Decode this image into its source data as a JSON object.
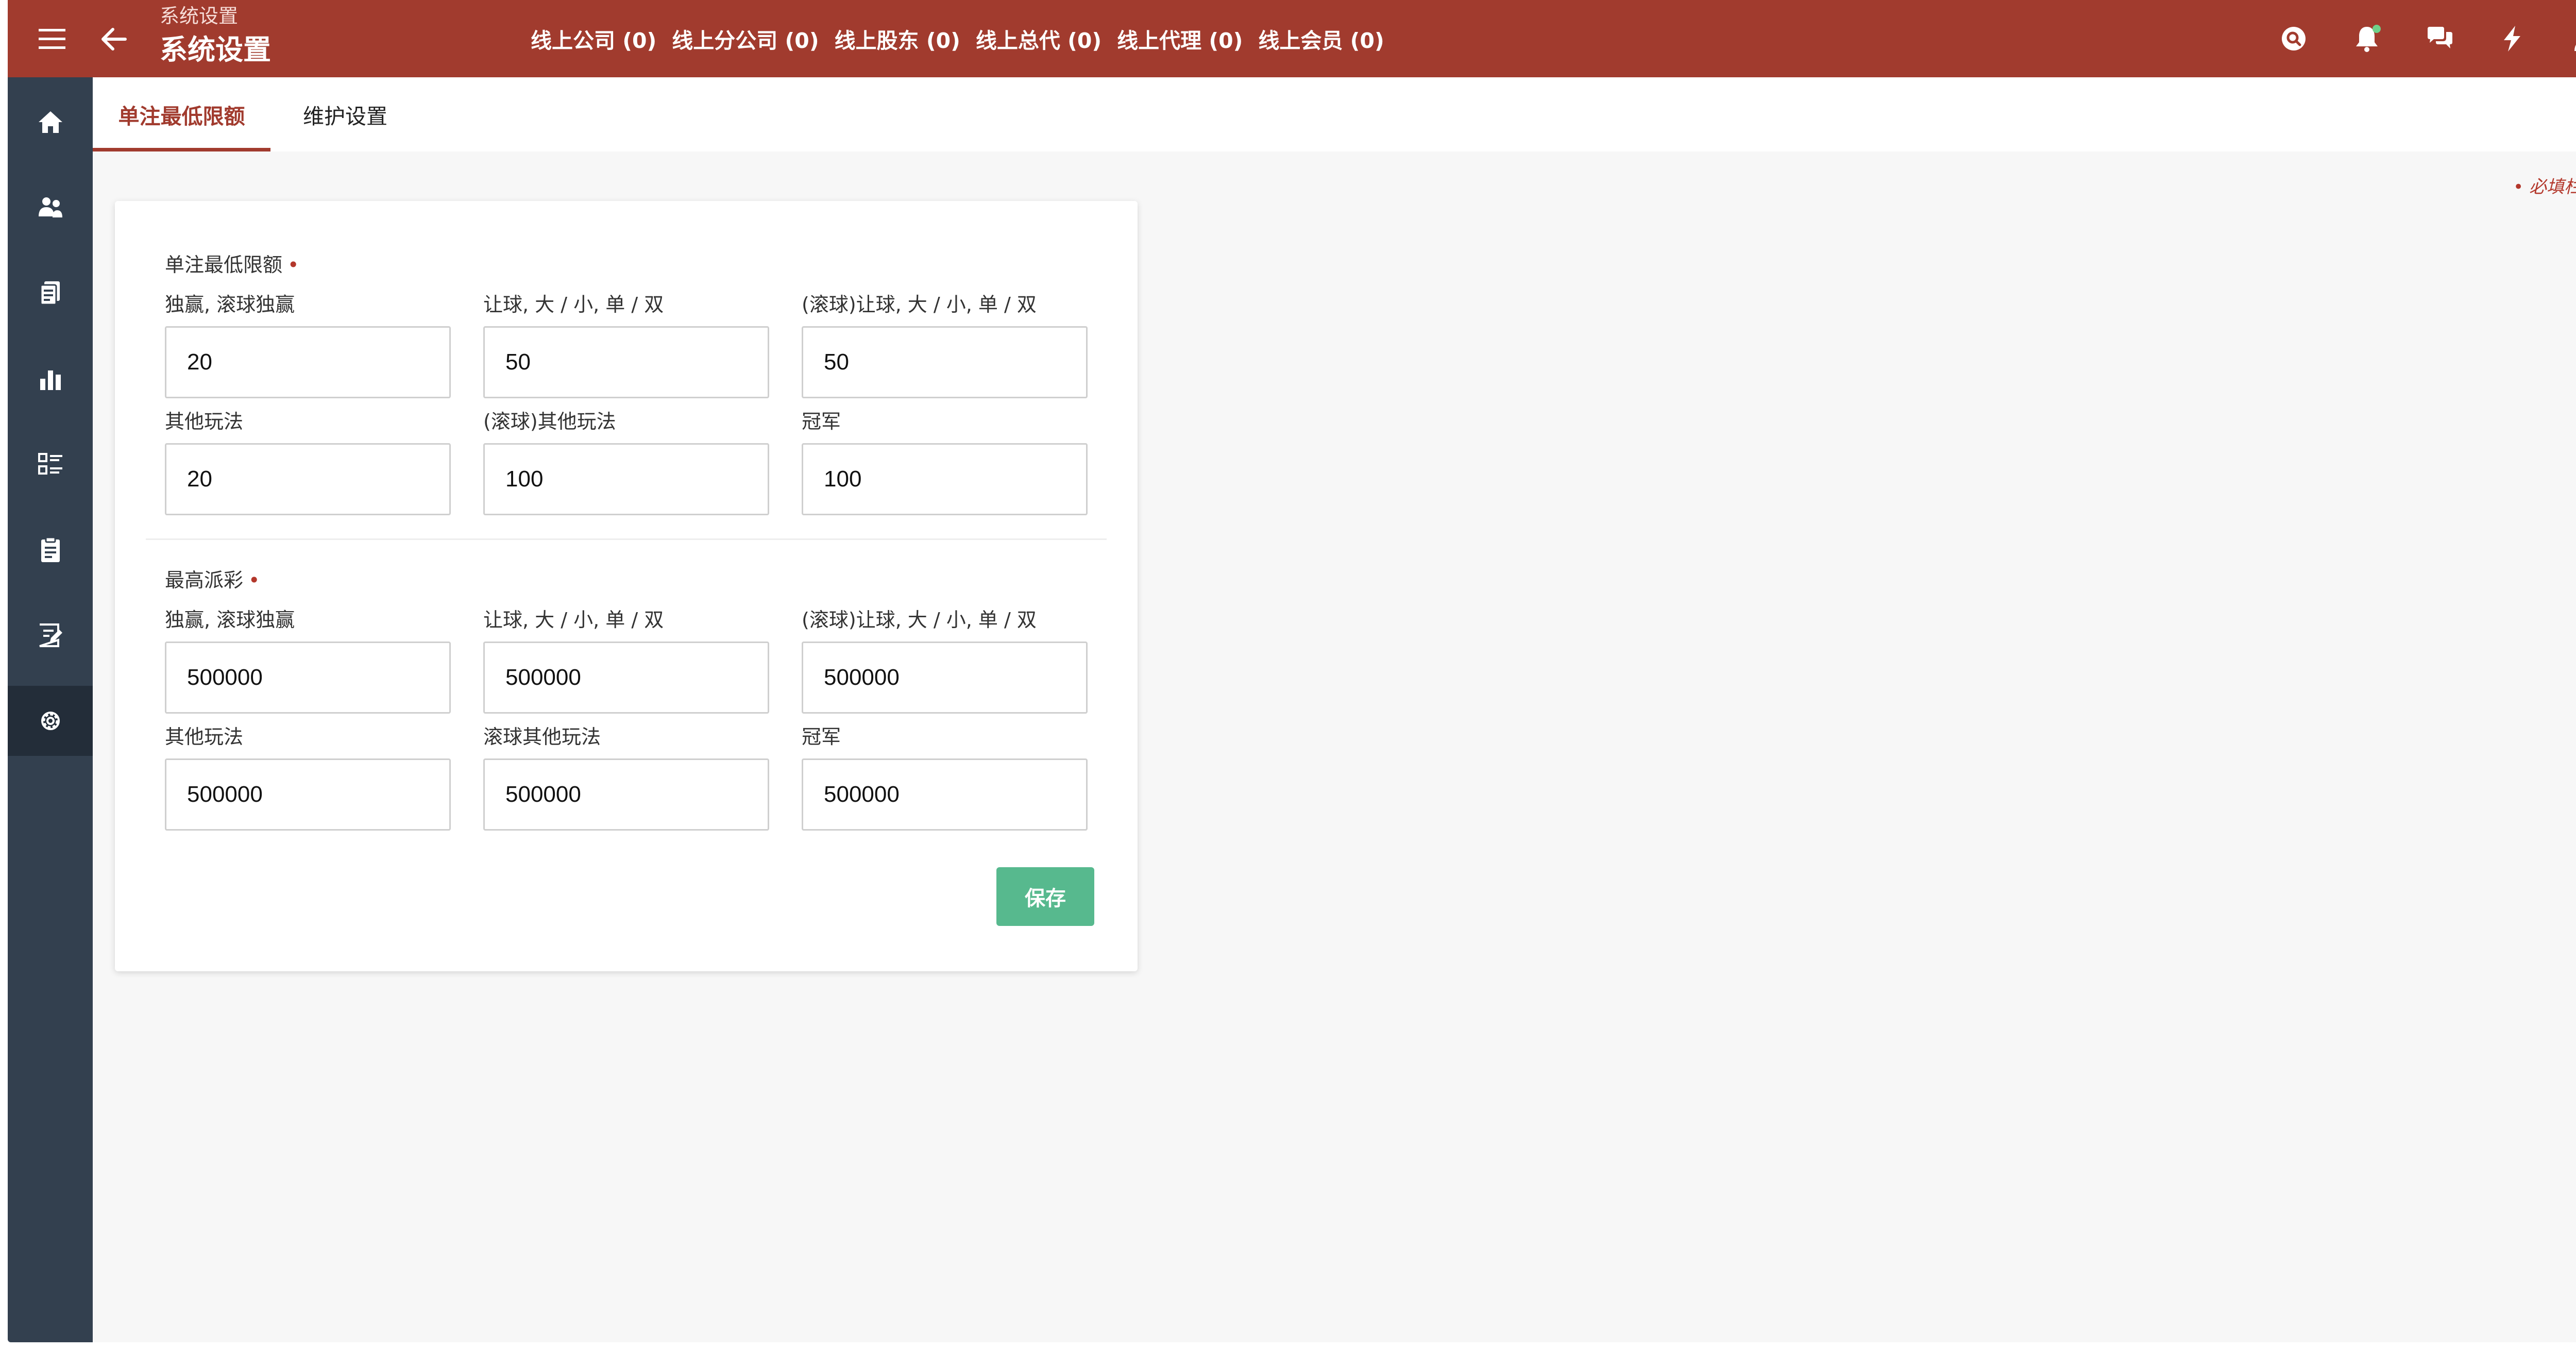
{
  "header": {
    "breadcrumb": "系统设置",
    "title": "系统设置",
    "stats": [
      {
        "label": "线上公司 (0)"
      },
      {
        "label": "线上分公司 (0)"
      },
      {
        "label": "线上股东 (0)"
      },
      {
        "label": "线上总代 (0)"
      },
      {
        "label": "线上代理 (0)"
      },
      {
        "label": "线上会员 (0)"
      }
    ],
    "icons": [
      "search-icon",
      "bell-icon",
      "chat-icon",
      "lightning-icon",
      "user-icon"
    ]
  },
  "sidebar": {
    "items": [
      "home-icon",
      "users-icon",
      "document-icon",
      "bar-chart-icon",
      "list-icon",
      "clipboard-icon",
      "edit-note-icon",
      "gear-icon"
    ],
    "active": "gear-icon"
  },
  "tabs": [
    {
      "label": "单注最低限额",
      "active": true
    },
    {
      "label": "维护设置",
      "active": false
    }
  ],
  "required_hint": "• 必填栏位",
  "form": {
    "min_section": {
      "title": "单注最低限额",
      "required_mark": "•",
      "fields": [
        {
          "label": "独赢, 滚球独赢",
          "value": "20"
        },
        {
          "label": "让球, 大 / 小, 单 / 双",
          "value": "50"
        },
        {
          "label": "(滚球)让球, 大 / 小, 单 / 双",
          "value": "50"
        },
        {
          "label": "其他玩法",
          "value": "20"
        },
        {
          "label": "(滚球)其他玩法",
          "value": "100"
        },
        {
          "label": "冠军",
          "value": "100"
        }
      ]
    },
    "max_section": {
      "title": "最高派彩",
      "required_mark": "•",
      "fields": [
        {
          "label": "独赢, 滚球独赢",
          "value": "500000"
        },
        {
          "label": "让球, 大 / 小, 单 / 双",
          "value": "500000"
        },
        {
          "label": "(滚球)让球, 大 / 小, 单 / 双",
          "value": "500000"
        },
        {
          "label": "其他玩法",
          "value": "500000"
        },
        {
          "label": "滚球其他玩法",
          "value": "500000"
        },
        {
          "label": "冠军",
          "value": "500000"
        }
      ]
    },
    "save_label": "保存"
  },
  "colors": {
    "header": "#a13b2e",
    "sidebar": "#33404f",
    "sidebar_active": "#232d39",
    "save_button": "#57b98e",
    "required": "#b3372b"
  }
}
